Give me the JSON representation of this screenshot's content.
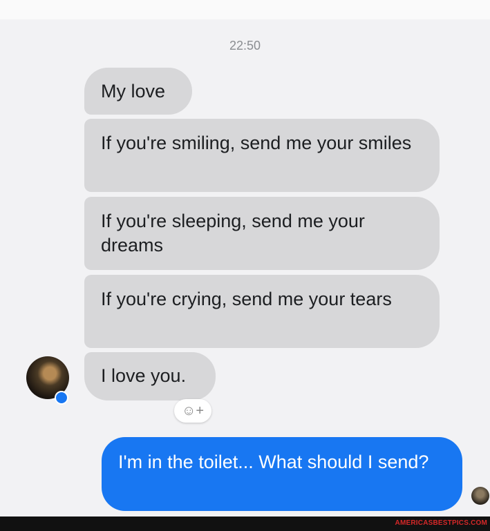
{
  "conversation": {
    "timestamp": "22:50",
    "received": [
      {
        "text": "My love"
      },
      {
        "text": "If you're smiling, send me your smiles"
      },
      {
        "text": "If you're sleeping, send me your dreams"
      },
      {
        "text": "If you're crying, send me your tears"
      },
      {
        "text": "I love you."
      }
    ],
    "reaction_icon": "add-reaction-icon",
    "sent": [
      {
        "text": "I'm in the toilet... What should I send?"
      }
    ]
  },
  "colors": {
    "received_bubble": "#d7d7d9",
    "sent_bubble": "#1877f2",
    "background": "#f2f2f4"
  },
  "watermark": "AMERICASBESTPICS.COM"
}
